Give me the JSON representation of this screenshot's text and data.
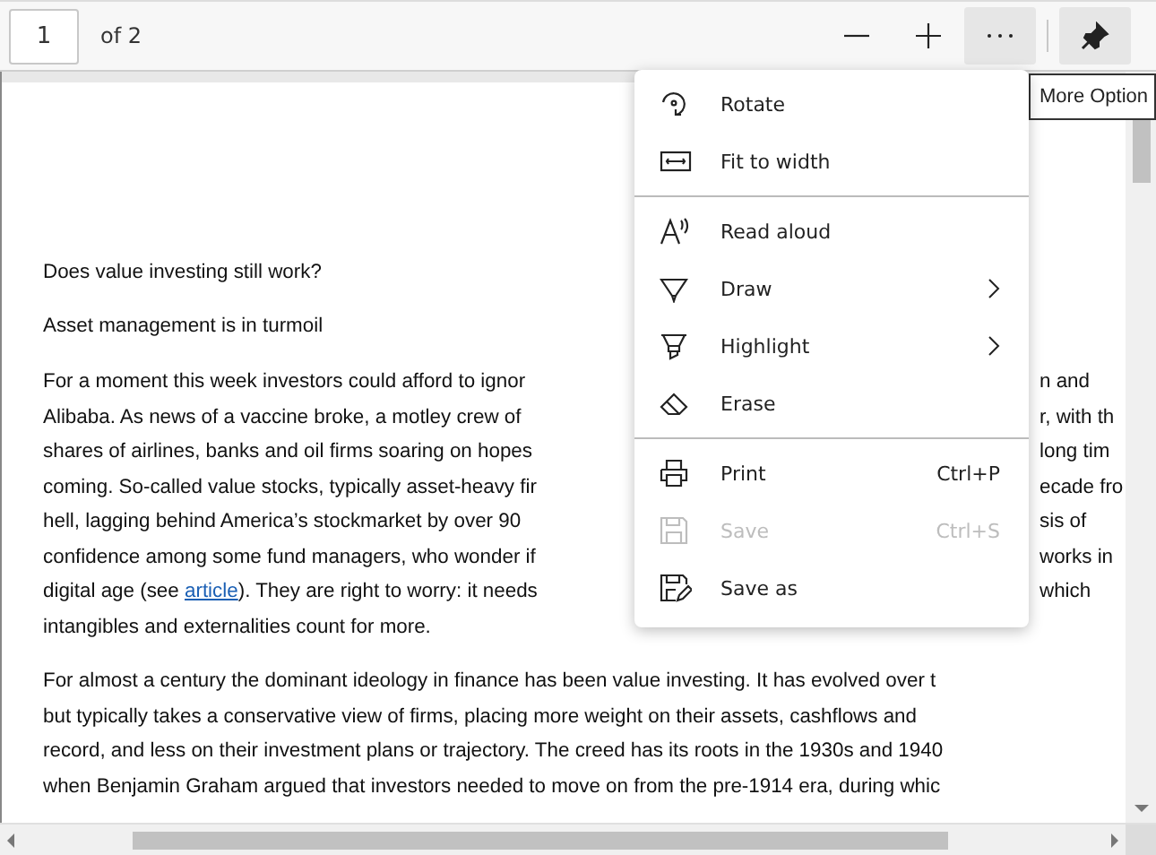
{
  "toolbar": {
    "page_field": {
      "value": "1"
    },
    "page_count": "of 2",
    "buttons": [
      {
        "kind": "zoom-out",
        "active": false
      },
      {
        "kind": "zoom-in",
        "active": false
      },
      {
        "kind": "more",
        "active": true
      },
      {
        "kind": "pin",
        "active": true
      }
    ]
  },
  "tooltip": "More Option",
  "document": {
    "headings": [
      "Does value investing still work?",
      "Asset management is in turmoil"
    ],
    "paragraphs": [
      [
        {
          "left": "For a moment this week investors could afford to ignor",
          "right": "n and"
        },
        {
          "left": "Alibaba. As news of a vaccine broke, a motley crew of",
          "right": "r, with th"
        },
        {
          "left": "shares of airlines, banks and oil firms soaring on hopes",
          "right": "long tim"
        },
        {
          "left": "coming. So-called value stocks, typically asset-heavy fir",
          "right": "ecade fro"
        },
        {
          "left": "hell, lagging behind America’s stockmarket by over 90",
          "right": "sis of"
        },
        {
          "left": "confidence among some fund managers, who wonder if",
          "right": "works in"
        },
        {
          "left": "digital age (see ",
          "link": "article",
          "after": "). They are right to worry: it needs",
          "right": "which"
        },
        {
          "left": "intangibles and externalities count for more."
        }
      ],
      [
        {
          "left": "For almost a century the dominant ideology in finance has been value investing. It has evolved over t"
        },
        {
          "left": "but typically takes a conservative view of firms, placing more weight on their assets, cashflows and"
        },
        {
          "left": "record, and less on their investment plans or trajectory. The creed has its roots in the 1930s and 1940"
        },
        {
          "left": "when Benjamin Graham argued that investors needed to move on from the pre-1914 era, during whic"
        }
      ]
    ]
  },
  "menu": {
    "groups": [
      [
        {
          "kind": "rotate",
          "label": "Rotate",
          "submenu": false,
          "disabled": false
        },
        {
          "kind": "fit",
          "label": "Fit to width",
          "submenu": false,
          "disabled": false
        }
      ],
      [
        {
          "kind": "read",
          "label": "Read aloud",
          "submenu": false,
          "disabled": false
        },
        {
          "kind": "draw",
          "label": "Draw",
          "submenu": true,
          "disabled": false
        },
        {
          "kind": "highlight",
          "label": "Highlight",
          "submenu": true,
          "disabled": false
        },
        {
          "kind": "erase",
          "label": "Erase",
          "submenu": false,
          "disabled": false
        }
      ],
      [
        {
          "kind": "print",
          "label": "Print",
          "shortcut": "Ctrl+P",
          "submenu": false,
          "disabled": false
        },
        {
          "kind": "save",
          "label": "Save",
          "shortcut": "Ctrl+S",
          "submenu": false,
          "disabled": true
        },
        {
          "kind": "saveas",
          "label": "Save as",
          "submenu": false,
          "disabled": false
        }
      ]
    ]
  }
}
